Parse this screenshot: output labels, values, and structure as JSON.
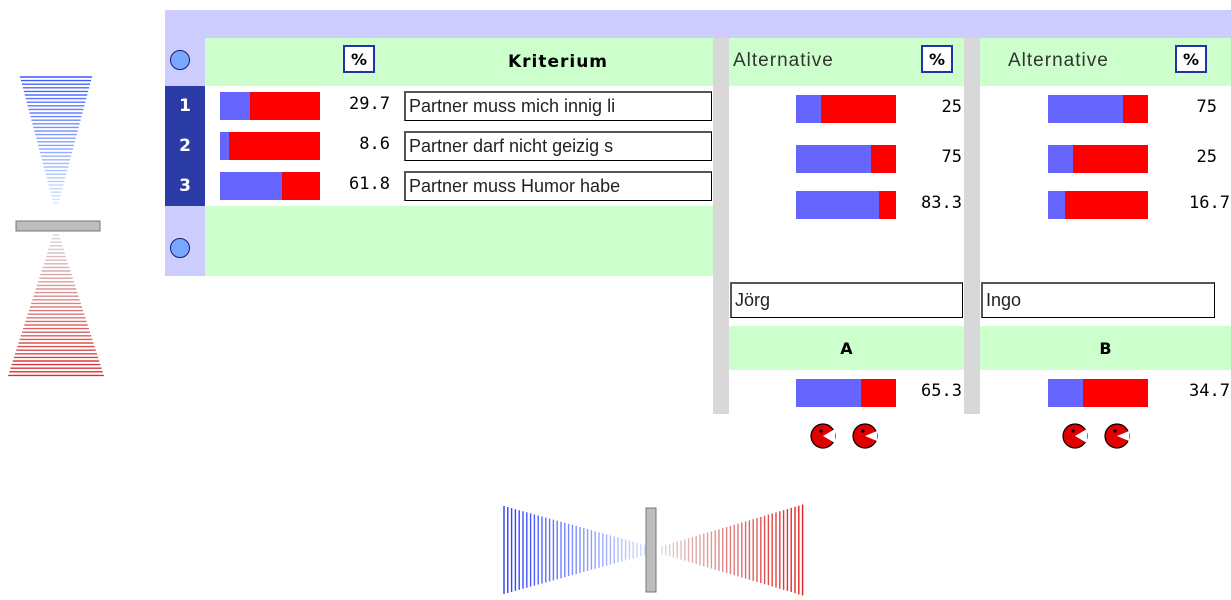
{
  "criteria_table": {
    "percent_label": "%",
    "header_title": "Kriterium",
    "rows": [
      {
        "num": "1",
        "weight_text": "29.7",
        "weight": 0.297,
        "text": "Partner muss mich innig li"
      },
      {
        "num": "2",
        "weight_text": "8.6",
        "weight": 0.086,
        "text": "Partner darf nicht geizig s"
      },
      {
        "num": "3",
        "weight_text": "61.8",
        "weight": 0.618,
        "text": "Partner muss Humor habe"
      }
    ]
  },
  "alternatives": [
    {
      "header": "Alternative",
      "percent_label": "%",
      "scores": [
        {
          "text": "25",
          "value": 0.25
        },
        {
          "text": "75",
          "value": 0.75
        },
        {
          "text": "83.3",
          "value": 0.833
        }
      ],
      "name": "Jörg",
      "letter": "A",
      "total_text": "65.3",
      "total": 0.653
    },
    {
      "header": "Alternative",
      "percent_label": "%",
      "scores": [
        {
          "text": "75",
          "value": 0.75
        },
        {
          "text": "25",
          "value": 0.25
        },
        {
          "text": "16.7",
          "value": 0.167
        }
      ],
      "name": "Ingo",
      "letter": "B",
      "total_text": "34.7",
      "total": 0.347
    }
  ],
  "icons": {
    "criteria_face": "sad-face-icon",
    "alternative_action": "pacman-icon",
    "left_widget": "hourglass-gradient-icon",
    "bottom_widget": "horizontal-gradient-slider-icon"
  },
  "colors": {
    "blue": "#6666ff",
    "red": "#ff0000",
    "green_header": "#ccffcc",
    "lavender": "#ccccff",
    "navy": "#2b3ca6"
  }
}
